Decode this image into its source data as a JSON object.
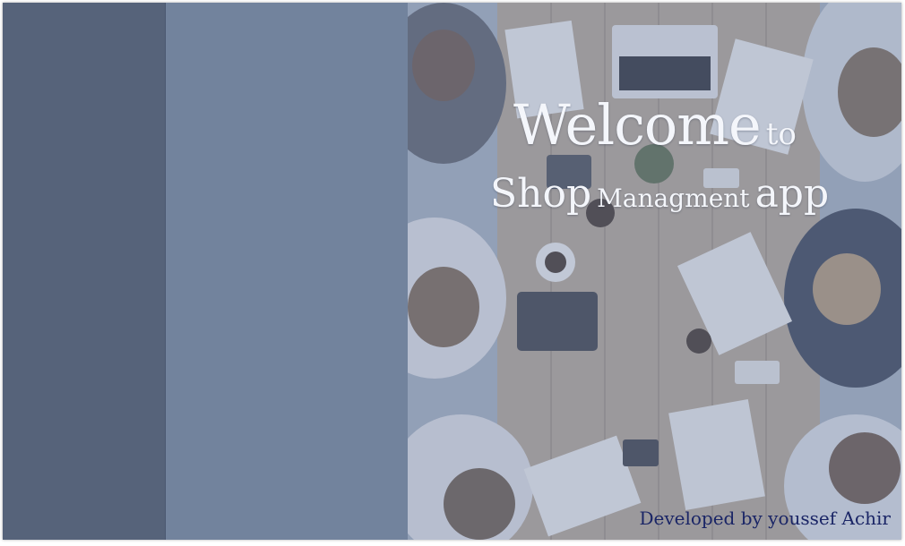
{
  "hero": {
    "welcome_word": "Welcome",
    "to_word": "to",
    "shop_word": "Shop",
    "managment_word": "Managment",
    "app_word": "app",
    "credit": "Developed by youssef Achir"
  },
  "colors": {
    "sidebar": "#56637a",
    "content_panel": "#72839d",
    "hero_text": "#f4f6fb",
    "credit_text": "#1a2566"
  }
}
